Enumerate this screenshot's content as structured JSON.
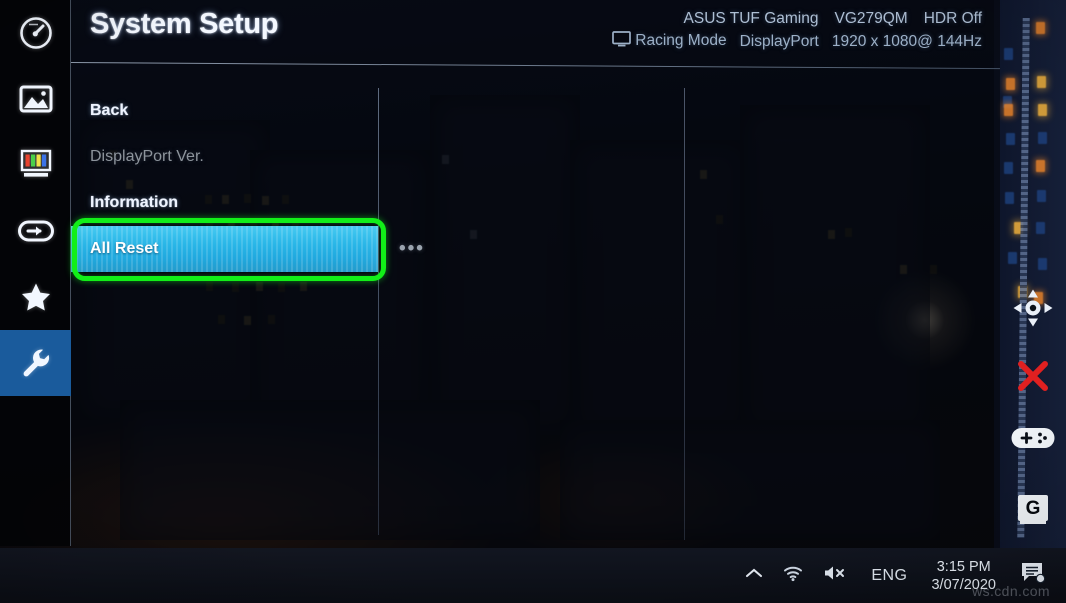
{
  "osd": {
    "title": "System Setup",
    "info": {
      "brand": "ASUS TUF Gaming",
      "model": "VG279QM",
      "hdr": "HDR Off",
      "mode": "Racing Mode",
      "input": "DisplayPort",
      "resolution": "1920 x 1080@ 144Hz",
      "monitor_icon": "monitor-icon"
    },
    "sidebar": {
      "items": [
        {
          "icon": "gauge-icon",
          "name": "gaming",
          "active": false
        },
        {
          "icon": "image-icon",
          "name": "image",
          "active": false
        },
        {
          "icon": "color-bars-icon",
          "name": "color",
          "active": false
        },
        {
          "icon": "input-select-icon",
          "name": "input-select",
          "active": false
        },
        {
          "icon": "star-icon",
          "name": "my-favorite",
          "active": false
        },
        {
          "icon": "wrench-icon",
          "name": "system-setup",
          "active": true
        }
      ]
    },
    "menu": {
      "items": [
        {
          "label": "Back",
          "state": "normal",
          "dots": ""
        },
        {
          "label": "DisplayPort Ver.",
          "state": "disabled",
          "dots": ""
        },
        {
          "label": "Information",
          "state": "normal",
          "dots": ""
        },
        {
          "label": "All Reset",
          "state": "selected",
          "dots": "•••"
        }
      ]
    },
    "annotation": {
      "target_label": "All Reset",
      "color": "#12ef18",
      "shape": "rounded-rectangle"
    },
    "colors": {
      "selection": "#27b4e6",
      "sidebar_active": "#1a5b9c",
      "annotation": "#12ef18",
      "close_x": "#e02020",
      "title_text": "#f4f8ff",
      "disabled_text": "#8d949c"
    },
    "controls": [
      {
        "icon": "five-way-navigation-icon",
        "name": "joystick-navigation"
      },
      {
        "icon": "close-x-icon",
        "name": "close-button"
      },
      {
        "icon": "gamepad-icon",
        "name": "gameplus-button"
      },
      {
        "icon": "g-letter-icon",
        "name": "gamevisual-button",
        "label": "G"
      }
    ]
  },
  "taskbar": {
    "show_hidden_icons_icon": "chevron-up-icon",
    "network_icon": "wifi-icon",
    "volume_icon": "speaker-muted-icon",
    "language": "ENG",
    "time": "3:15 PM",
    "date": "3/07/2020",
    "notifications_icon": "notification-bubble-icon"
  },
  "watermark": "ws.cdn.com"
}
